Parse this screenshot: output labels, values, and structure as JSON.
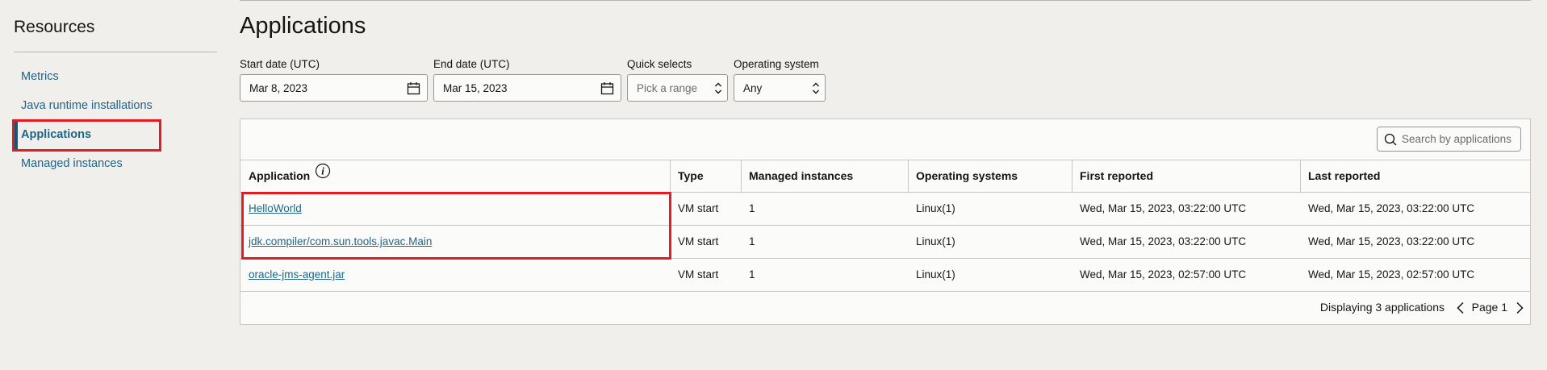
{
  "sidebar": {
    "title": "Resources",
    "items": [
      {
        "label": "Metrics"
      },
      {
        "label": "Java runtime installations"
      },
      {
        "label": "Applications"
      },
      {
        "label": "Managed instances"
      }
    ]
  },
  "page": {
    "title": "Applications"
  },
  "filters": {
    "start_date": {
      "label": "Start date (UTC)",
      "value": "Mar 8, 2023"
    },
    "end_date": {
      "label": "End date (UTC)",
      "value": "Mar 15, 2023"
    },
    "quick_selects": {
      "label": "Quick selects",
      "placeholder": "Pick a range"
    },
    "os": {
      "label": "Operating system",
      "value": "Any"
    }
  },
  "search": {
    "placeholder": "Search by applications"
  },
  "table": {
    "headers": [
      "Application",
      "Type",
      "Managed instances",
      "Operating systems",
      "First reported",
      "Last reported"
    ],
    "rows": [
      [
        "HelloWorld",
        "VM start",
        "1",
        "Linux(1)",
        "Wed, Mar 15, 2023, 03:22:00 UTC",
        "Wed, Mar 15, 2023, 03:22:00 UTC"
      ],
      [
        "jdk.compiler/com.sun.tools.javac.Main",
        "VM start",
        "1",
        "Linux(1)",
        "Wed, Mar 15, 2023, 03:22:00 UTC",
        "Wed, Mar 15, 2023, 03:22:00 UTC"
      ],
      [
        "oracle-jms-agent.jar",
        "VM start",
        "1",
        "Linux(1)",
        "Wed, Mar 15, 2023, 02:57:00 UTC",
        "Wed, Mar 15, 2023, 02:57:00 UTC"
      ]
    ]
  },
  "pagination": {
    "summary": "Displaying 3 applications",
    "page": "Page 1"
  },
  "colors": {
    "highlight": "#e31b23",
    "link": "#1f6586",
    "active_nav": "#0f5879"
  },
  "icons": {
    "calendar": "calendar-icon",
    "search": "search-icon",
    "info": "info-icon",
    "select": "chevron-updown-icon"
  }
}
